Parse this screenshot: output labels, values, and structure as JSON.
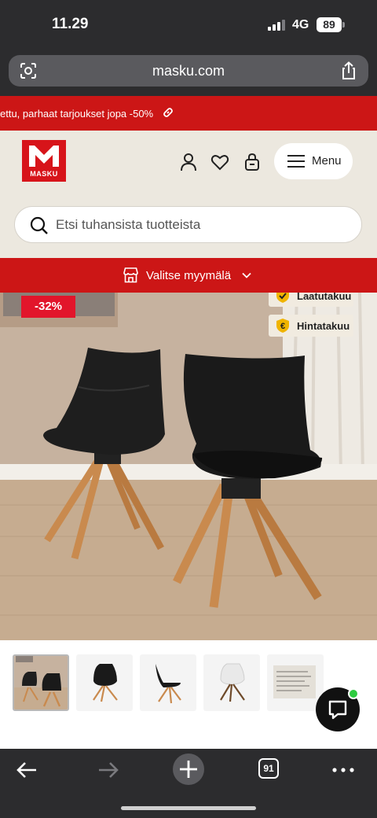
{
  "status_bar": {
    "time": "11.29",
    "network": "4G",
    "battery": "89"
  },
  "browser": {
    "url": "masku.com",
    "tab_count": "91"
  },
  "promo": {
    "text": "ettu, parhaat tarjoukset jopa -50%"
  },
  "header": {
    "logo_text": "MASKU",
    "menu_label": "Menu",
    "search_placeholder": "Etsi tuhansista tuotteista"
  },
  "store_selector": {
    "label": "Valitse myymälä"
  },
  "product": {
    "discount": "-32%",
    "guarantees": [
      "Laatutakuu",
      "Hintatakuu"
    ]
  },
  "thumbnails": [
    {
      "name": "thumbnail-pair",
      "active": true
    },
    {
      "name": "thumbnail-front",
      "active": false
    },
    {
      "name": "thumbnail-side",
      "active": false
    },
    {
      "name": "thumbnail-white",
      "active": false
    },
    {
      "name": "thumbnail-spec",
      "active": false
    }
  ],
  "colors": {
    "brand_red": "#cc1616",
    "badge_red": "#e2152b",
    "header_bg": "#ece8df",
    "browser_chrome": "#2c2c2e",
    "online_green": "#2ecc40"
  },
  "icons": [
    "person-icon",
    "heart-icon",
    "bag-icon",
    "menu-icon",
    "search-icon",
    "store-icon",
    "chevron-down-icon",
    "link-icon",
    "share-icon",
    "chat-icon"
  ]
}
